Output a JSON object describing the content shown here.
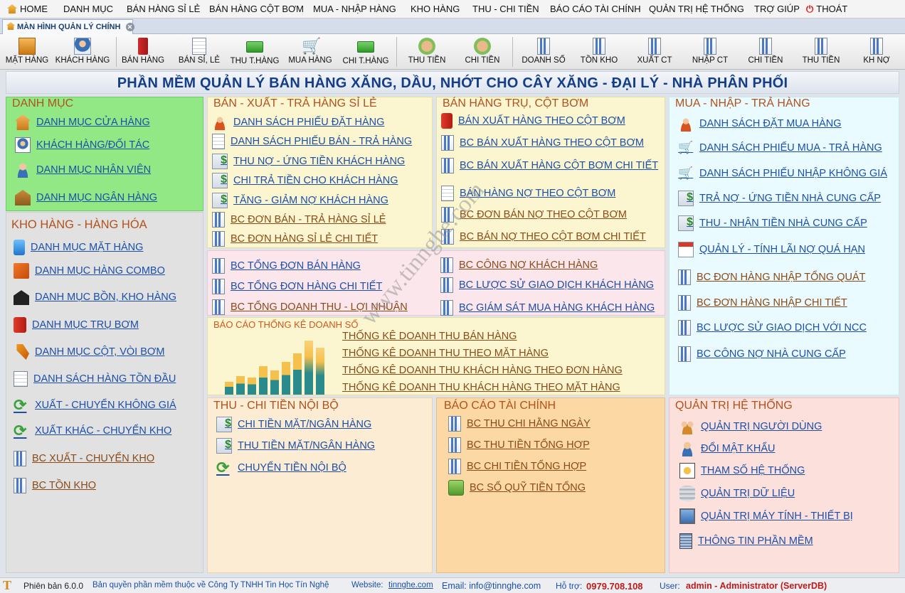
{
  "menu": [
    "HOME",
    "DANH MỤC",
    "BÁN HÀNG SỈ LẺ",
    "BÁN HÀNG CỘT BƠM",
    "MUA - NHẬP HÀNG",
    "KHO HÀNG",
    "THU - CHI TIỀN",
    "BÁO CÁO TÀI CHÍNH",
    "QUẢN TRỊ HỆ THỐNG",
    "TRỢ GIÚP",
    "THOÁT"
  ],
  "tab": "MÀN HÌNH QUẢN LÝ CHÍNH",
  "toolbar": [
    "MẶT HÀNG",
    "KHÁCH HÀNG",
    "BÁN HÀNG",
    "BÁN SỈ, LẺ",
    "THU T.HÀNG",
    "MUA HÀNG",
    "CHI T.HÀNG",
    "THU TIỀN",
    "CHI TIỀN",
    "DOANH SỐ",
    "TỒN KHO",
    "XUẤT CT",
    "NHẬP CT",
    "CHI TIỀN",
    "THU TIỀN",
    "KH NỢ"
  ],
  "banner": "PHẦN MỀM QUẢN LÝ BÁN HÀNG XĂNG, DẦU, NHỚT CHO CÂY XĂNG - ĐẠI LÝ - NHÀ PHÂN PHỐI",
  "danhmuc": {
    "title": "DANH MỤC",
    "items": [
      "DANH MỤC CỬA HÀNG",
      "KHÁCH HÀNG/ĐỐI TÁC",
      "DANH MỤC NHÂN VIÊN",
      "DANH MỤC NGÂN HÀNG"
    ]
  },
  "kho": {
    "title": "KHO HÀNG - HÀNG HÓA",
    "items": [
      "DANH MỤC MẶT HÀNG",
      "DANH MỤC HÀNG COMBO",
      "DANH MỤC BỒN, KHO HÀNG",
      "DANH MỤC TRỤ BƠM",
      "DANH MỤC CỘT, VÒI BƠM",
      "DANH SÁCH HÀNG TỒN ĐẦU",
      "XUẤT - CHUYỂN KHÔNG GIÁ",
      "XUẤT KHÁC - CHUYỂN KHO",
      "BC XUẤT - CHUYỂN KHO",
      "BC TỒN KHO"
    ]
  },
  "banxuat": {
    "title": "BÁN - XUẤT - TRẢ HÀNG SỈ LẺ",
    "items": [
      "DANH SÁCH PHIẾU ĐẶT HÀNG",
      "DANH SÁCH PHIẾU BÁN - TRẢ HÀNG",
      "THU NỢ - ỨNG TIỀN KHÁCH HÀNG",
      "CHI TRẢ TIỀN CHO KHÁCH HÀNG",
      "TĂNG - GIẢM NỢ KHÁCH HÀNG",
      "BC ĐƠN BÁN - TRẢ HÀNG SỈ LẺ",
      "BC ĐƠN HÀNG SỈ LẺ CHI TIẾT"
    ]
  },
  "cotbom": {
    "title": "BÁN HÀNG TRỤ, CỘT BƠM",
    "items": [
      "BÁN XUẤT HÀNG THEO CỘT BƠM",
      "BC  BÁN XUẤT HÀNG THEO CỘT BƠM",
      "BC BÁN XUẤT HÀNG CỘT BƠM CHI TIẾT",
      "BÁN HÀNG NỢ THEO CỘT BƠM",
      "BC ĐƠN BÁN NỢ THEO CỘT BƠM",
      "BC BÁN NỢ THEO CỘT BƠM CHI TIẾT"
    ]
  },
  "tonghop": {
    "left": [
      "BC TỔNG ĐƠN BÁN HÀNG",
      "BC TỔNG ĐƠN HÀNG CHI TIẾT",
      "BC TỔNG DOANH THU - LỢI NHUẬN"
    ],
    "right": [
      "BC CÔNG NỢ KHÁCH HÀNG",
      "BC LƯỢC SỬ GIAO DỊCH KHÁCH HÀNG",
      "BC GIÁM SÁT MUA HÀNG KHÁCH HÀNG"
    ]
  },
  "thongke": {
    "title": "BÁO CÁO THỐNG KÊ DOANH SỐ",
    "items": [
      "THỐNG KÊ DOANH THU BÁN HÀNG",
      "THỐNG KÊ DOANH THU THEO MẶT HÀNG",
      "THỐNG KÊ DOANH THU KHÁCH HÀNG THEO ĐƠN HÀNG",
      "THỐNG KÊ DOANH THU KHÁCH HÀNG THEO MẶT HÀNG"
    ]
  },
  "mua": {
    "title": "MUA - NHẬP - TRẢ HÀNG",
    "items": [
      "DANH SÁCH ĐẶT MUA HÀNG",
      "DANH SÁCH PHIẾU MUA - TRẢ HÀNG",
      "DANH SÁCH PHIẾU NHẬP KHÔNG GIÁ",
      "TRẢ NỢ - ỨNG TIỀN NHÀ CUNG CẤP",
      "THU - NHẬN TIỀN NHÀ CUNG CẤP",
      "QUẢN LÝ - TÍNH LÃI  NỢ QUÁ HẠN",
      "BC ĐƠN HÀNG NHẬP TỔNG QUÁT",
      "BC ĐƠN HÀNG NHẬP CHI TIẾT",
      "BC LƯỢC SỬ GIAO DỊCH VỚI NCC",
      "BC CÔNG NỢ NHÀ CUNG CẤP"
    ]
  },
  "thuchi": {
    "title": "THU - CHI TIỀN NỘI BỘ",
    "items": [
      "CHI TIỀN MẶT/NGÂN HÀNG",
      "THU TIỀN MẶT/NGÂN HÀNG",
      "CHUYỂN TIỀN NỘI BỘ"
    ]
  },
  "taichinh": {
    "title": "BÁO CÁO TÀI CHÍNH",
    "items": [
      "BC THU CHI HẰNG NGÀY",
      "BC THU TIỀN TỔNG HỢP",
      "BC CHI TIỀN TỔNG HỢP",
      "BC SỔ QUỸ TIỀN TỔNG"
    ]
  },
  "quantri": {
    "title": "QUẢN TRỊ HỆ THỐNG",
    "items": [
      "QUẢN TRỊ NGƯỜI DÙNG",
      "ĐỔI MẬT KHẨU",
      "THAM SỐ HỆ THỐNG",
      "QUẢN TRỊ DỮ LIỆU",
      "QUẢN TRỊ MÁY TÍNH - THIẾT BỊ",
      "THÔNG TIN PHẦN MỀM"
    ]
  },
  "status": {
    "version": "Phiên bản 6.0.0",
    "copyright": "Bản quyền phần mềm thuộc về Công Ty TNHH Tin Học Tín Nghệ",
    "web_label": "Website:",
    "web": "tinnghe.com",
    "email": "Email: info@tinnghe.com",
    "support_label": "Hỗ trợ:",
    "phone": "0979.708.108",
    "user_label": "User:",
    "user": "admin - Administrator (ServerDB)"
  },
  "watermark": "www.tinnghe.com"
}
